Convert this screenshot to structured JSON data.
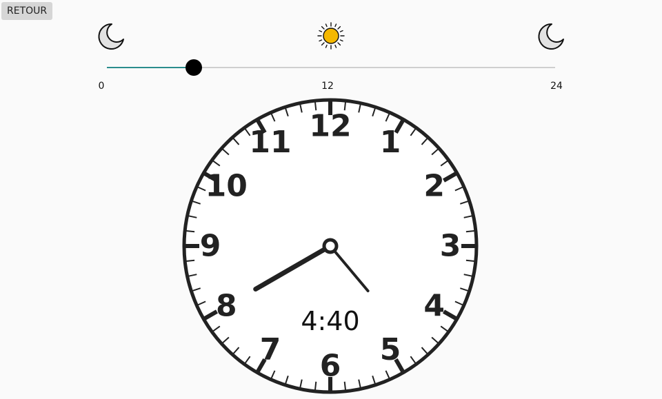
{
  "app": {
    "back_label": "RETOUR"
  },
  "day_slider": {
    "min_label": "0",
    "mid_label": "12",
    "max_label": "24",
    "min": 0,
    "max": 24,
    "value": 4.67,
    "icons": [
      "moon-icon",
      "sun-icon",
      "moon-icon"
    ]
  },
  "clock": {
    "time_text": "4:40",
    "hours": 4,
    "minutes": 40,
    "numerals": [
      "12",
      "1",
      "2",
      "3",
      "4",
      "5",
      "6",
      "7",
      "8",
      "9",
      "10",
      "11"
    ]
  },
  "colors": {
    "slider_fill": "#2a8c8c",
    "slider_track": "#cfcfcf",
    "sun": "#f5b800",
    "moon": "#e2e2e2",
    "clock_ink": "#222222"
  }
}
